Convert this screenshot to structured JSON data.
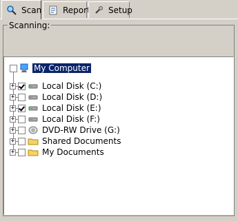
{
  "tabs": [
    {
      "label": "Scan",
      "icon": "search-icon"
    },
    {
      "label": "Report",
      "icon": "report-icon"
    },
    {
      "label": "Setup",
      "icon": "settings-icon"
    }
  ],
  "group": {
    "title": "Scanning:"
  },
  "tree": {
    "items": [
      {
        "label": "My Computer",
        "expander": "",
        "checked": false,
        "icon": "computer-icon",
        "selected": true
      },
      {
        "label": "Local Disk (C:)",
        "expander": "+",
        "checked": true,
        "icon": "disk-icon",
        "selected": false
      },
      {
        "label": "Local Disk (D:)",
        "expander": "+",
        "checked": false,
        "icon": "disk-icon",
        "selected": false
      },
      {
        "label": "Local Disk (E:)",
        "expander": "+",
        "checked": true,
        "icon": "disk-icon",
        "selected": false
      },
      {
        "label": "Local Disk (F:)",
        "expander": "+",
        "checked": false,
        "icon": "disk-icon",
        "selected": false
      },
      {
        "label": "DVD-RW Drive (G:)",
        "expander": "+",
        "checked": false,
        "icon": "dvd-icon",
        "selected": false
      },
      {
        "label": "Shared Documents",
        "expander": "+",
        "checked": false,
        "icon": "folder-icon",
        "selected": false
      },
      {
        "label": "My Documents",
        "expander": "+",
        "checked": false,
        "icon": "folder-icon",
        "selected": false
      }
    ]
  }
}
